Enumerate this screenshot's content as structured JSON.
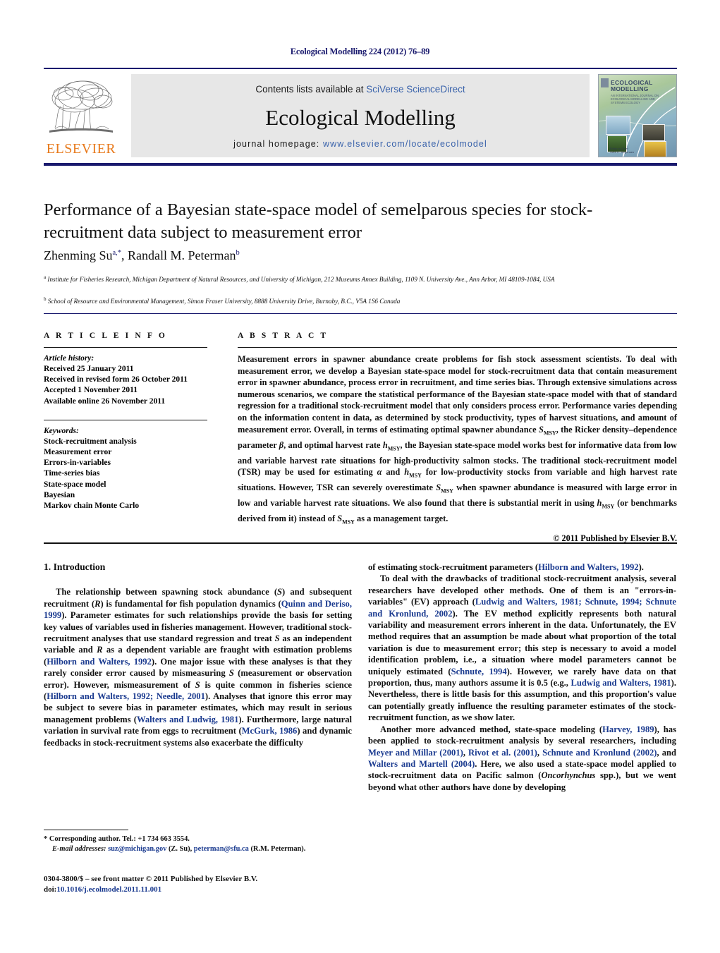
{
  "running_head": "Ecological Modelling 224 (2012) 76–89",
  "masthead": {
    "publisher_logo_text": "ELSEVIER",
    "contents_prefix": "Contents lists available at ",
    "contents_link": "SciVerse ScienceDirect",
    "journal_title": "Ecological Modelling",
    "homepage_prefix": "journal homepage: ",
    "homepage_url": "www.elsevier.com/locate/ecolmodel",
    "cover": {
      "title_line1": "ECOLOGICAL",
      "title_line2": "MODELLING",
      "subtitle": "AN INTERNATIONAL JOURNAL ON ECOLOGICAL MODELLING AND SYSTEMS ECOLOGY",
      "footer_line1": "Editor-in-Chief",
      "footer_line2": "Sven E. Jørgensen"
    }
  },
  "article": {
    "title": "Performance of a Bayesian state-space model of semelparous species for stock-recruitment data subject to measurement error",
    "authors_plain": "Zhenming Su",
    "author1": "Zhenming Su",
    "author1_sup": "a,*",
    "author2": ", Randall M. Peterman",
    "author2_sup": "b",
    "affiliation_a_sup": "a",
    "affiliation_a": "Institute for Fisheries Research, Michigan Department of Natural Resources, and University of Michigan, 212 Museums Annex Building, 1109 N. University Ave., Ann Arbor, MI 48109-1084, USA",
    "affiliation_b_sup": "b",
    "affiliation_b": "School of Resource and Environmental Management, Simon Fraser University, 8888 University Drive, Burnaby, B.C., V5A 1S6 Canada"
  },
  "article_info": {
    "heading": "A R T I C L E   I N F O",
    "history_label": "Article history:",
    "history": [
      "Received 25 January 2011",
      "Received in revised form 26 October 2011",
      "Accepted 1 November 2011",
      "Available online 26 November 2011"
    ],
    "keywords_label": "Keywords:",
    "keywords": [
      "Stock-recruitment analysis",
      "Measurement error",
      "Errors-in-variables",
      "Time-series bias",
      "State-space model",
      "Bayesian",
      "Markov chain Monte Carlo"
    ]
  },
  "abstract": {
    "heading": "A B S T R A C T",
    "copyright": "© 2011 Published by Elsevier B.V.",
    "paragraph_parts": [
      {
        "t": "Measurement errors in spawner abundance create problems for fish stock assessment scientists. To deal with measurement error, we develop a Bayesian state-space model for stock-recruitment data that contain measurement error in spawner abundance, process error in recruitment, and time series bias. Through extensive simulations across numerous scenarios, we compare the statistical performance of the Bayesian state-space model with that of standard regression for a traditional stock-recruitment model that only considers process error. Performance varies depending on the information content in data, as determined by stock productivity, types of harvest situations, and amount of measurement error. Overall, in terms of estimating optimal spawner abundance "
      },
      {
        "t": "S",
        "style": "i"
      },
      {
        "t": "MSY",
        "style": "sub"
      },
      {
        "t": ", the Ricker density–dependence parameter "
      },
      {
        "t": "β",
        "style": "i"
      },
      {
        "t": ", and optimal harvest rate "
      },
      {
        "t": "h",
        "style": "i"
      },
      {
        "t": "MSY",
        "style": "sub"
      },
      {
        "t": ", the Bayesian state-space model works best for informative data from low and variable harvest rate situations for high-productivity salmon stocks. The traditional stock-recruitment model (TSR) may be used for estimating "
      },
      {
        "t": "α",
        "style": "i"
      },
      {
        "t": " and "
      },
      {
        "t": "h",
        "style": "i"
      },
      {
        "t": "MSY",
        "style": "sub"
      },
      {
        "t": " for low-productivity stocks from variable and high harvest rate situations. However, TSR can severely overestimate "
      },
      {
        "t": "S",
        "style": "i"
      },
      {
        "t": "MSY",
        "style": "sub"
      },
      {
        "t": " when spawner abundance is measured with large error in low and variable harvest rate situations. We also found that there is substantial merit in using "
      },
      {
        "t": "h",
        "style": "i"
      },
      {
        "t": "MSY",
        "style": "sub"
      },
      {
        "t": " (or benchmarks derived from it) instead of "
      },
      {
        "t": "S",
        "style": "i"
      },
      {
        "t": "MSY",
        "style": "sub"
      },
      {
        "t": " as a management target."
      }
    ]
  },
  "introduction": {
    "heading": "1.  Introduction",
    "left_paragraphs": [
      [
        {
          "t": "The relationship between spawning stock abundance ("
        },
        {
          "t": "S",
          "style": "i"
        },
        {
          "t": ") and subsequent recruitment ("
        },
        {
          "t": "R",
          "style": "i"
        },
        {
          "t": ") is fundamental for fish population dynamics ("
        },
        {
          "t": "Quinn and Deriso, 1999",
          "style": "ref"
        },
        {
          "t": "). Parameter estimates for such relationships provide the basis for setting key values of variables used in fisheries management. However, traditional stock-recruitment analyses that use standard regression and treat "
        },
        {
          "t": "S",
          "style": "i"
        },
        {
          "t": " as an independent variable and "
        },
        {
          "t": "R",
          "style": "i"
        },
        {
          "t": " as a dependent variable are fraught with estimation problems ("
        },
        {
          "t": "Hilborn and Walters, 1992",
          "style": "ref"
        },
        {
          "t": "). One major issue with these analyses is that they rarely consider error caused by mismeasuring "
        },
        {
          "t": "S",
          "style": "i"
        },
        {
          "t": " (measurement or observation error). However, mismeasurement of "
        },
        {
          "t": "S",
          "style": "i"
        },
        {
          "t": " is quite common in fisheries science ("
        },
        {
          "t": "Hilborn and Walters, 1992; Needle, 2001",
          "style": "ref"
        },
        {
          "t": "). Analyses that ignore this error may be subject to severe bias in parameter estimates, which may result in serious management problems ("
        },
        {
          "t": "Walters and Ludwig, 1981",
          "style": "ref"
        },
        {
          "t": "). Furthermore, large natural variation in survival rate from eggs to recruitment ("
        },
        {
          "t": "McGurk, 1986",
          "style": "ref"
        },
        {
          "t": ") and dynamic feedbacks in stock-recruitment systems also exacerbate the difficulty"
        }
      ]
    ],
    "right_paragraphs": [
      [
        {
          "t": "of estimating stock-recruitment parameters ("
        },
        {
          "t": "Hilborn and Walters, 1992",
          "style": "ref"
        },
        {
          "t": ")."
        }
      ],
      [
        {
          "t": "To deal with the drawbacks of traditional stock-recruitment analysis, several researchers have developed other methods. One of them is an \"errors-in-variables\" (EV) approach ("
        },
        {
          "t": "Ludwig and Walters, 1981; Schnute, 1994; Schnute and Kronlund, 2002",
          "style": "ref"
        },
        {
          "t": "). The EV method explicitly represents both natural variability and measurement errors inherent in the data. Unfortunately, the EV method requires that an assumption be made about what proportion of the total variation is due to measurement error; this step is necessary to avoid a model identification problem, i.e., a situation where model parameters cannot be uniquely estimated ("
        },
        {
          "t": "Schnute, 1994",
          "style": "ref"
        },
        {
          "t": "). However, we rarely have data on that proportion, thus, many authors assume it is 0.5 (e.g., "
        },
        {
          "t": "Ludwig and Walters, 1981",
          "style": "ref"
        },
        {
          "t": "). Nevertheless, there is little basis for this assumption, and this proportion's value can potentially greatly influence the resulting parameter estimates of the stock-recruitment function, as we show later."
        }
      ],
      [
        {
          "t": "Another more advanced method, state-space modeling ("
        },
        {
          "t": "Harvey, 1989",
          "style": "ref"
        },
        {
          "t": "), has been applied to stock-recruitment analysis by several researchers, including "
        },
        {
          "t": "Meyer and Millar (2001)",
          "style": "ref"
        },
        {
          "t": ", "
        },
        {
          "t": "Rivot et al. (2001)",
          "style": "ref"
        },
        {
          "t": ", "
        },
        {
          "t": "Schnute and Kronlund (2002)",
          "style": "ref"
        },
        {
          "t": ", and "
        },
        {
          "t": "Walters and Martell (2004)",
          "style": "ref"
        },
        {
          "t": ". Here, we also used a state-space model applied to stock-recruitment data on Pacific salmon ("
        },
        {
          "t": "Oncorhynchus",
          "style": "i"
        },
        {
          "t": " spp.), but we went beyond what other authors have done by developing"
        }
      ]
    ]
  },
  "footer": {
    "corresponding_marker": "*",
    "corresponding": "Corresponding author. Tel.: +1 734 663 3554.",
    "email_label": "E-mail addresses:",
    "email1": "suz@michigan.gov",
    "email1_who": " (Z. Su),",
    "email2": "peterman@sfu.ca",
    "email2_who": " (R.M. Peterman).",
    "issn_line": "0304-3800/$ – see front matter © 2011 Published by Elsevier B.V.",
    "doi_label": "doi:",
    "doi_value": "10.1016/j.ecolmodel.2011.11.001"
  },
  "colors": {
    "rule_navy": "#1a1a6e",
    "link_blue": "#1a3a8f",
    "sd_blue": "#3a63ab",
    "elsevier_orange": "#e87b1e",
    "band_gray": "#e7e7e7"
  }
}
